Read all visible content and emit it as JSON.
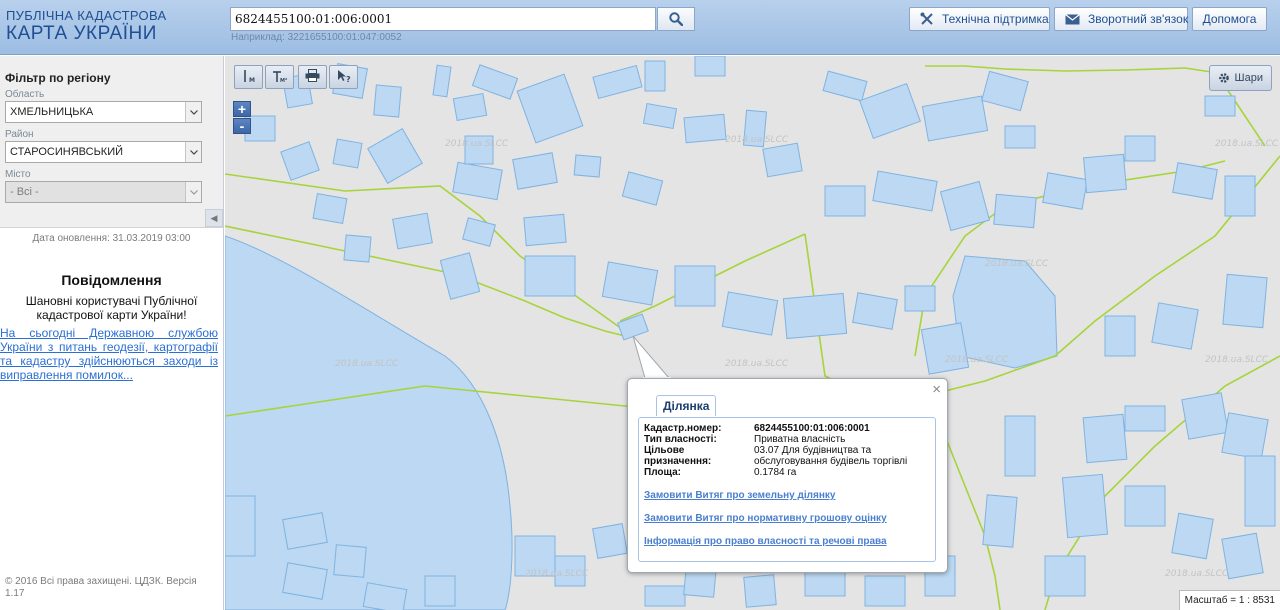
{
  "header": {
    "logo_line1": "ПУБЛІЧНА КАДАСТРОВА",
    "logo_line2": "КАРТА УКРАЇНИ",
    "search_value": "6824455100:01:006:0001",
    "search_hint": "Наприклад: 3221655100:01:047:0052",
    "search_icon": "search-icon",
    "support_label": "Технічна підтримка",
    "feedback_label": "Зворотний зв'язок",
    "help_label": "Допомога"
  },
  "sidebar": {
    "filter_title": "Фільтр по регіону",
    "region_label": "Область",
    "region_value": "ХМЕЛЬНИЦЬКА",
    "district_label": "Район",
    "district_value": "СТАРОСИНЯВСЬКИЙ",
    "city_label": "Місто",
    "city_value": "- Всі -",
    "update_text": "Дата оновлення: 31.03.2019 03:00",
    "notice_title": "Повідомлення",
    "notice_text": "Шановні користувачі Публічної кадастрової карти України!",
    "notice_link": "На сьогодні Державною службою України з питань геодезії, картографії та кадастру здійснюються заходи із виправлення помилок...",
    "copyright": "© 2016 Всі права захищені. ЦДЗК. Версія 1.17"
  },
  "map": {
    "layers_label": "Шари",
    "zoom_in": "+",
    "zoom_out": "-",
    "scale_text": "Масштаб = 1 : 8531",
    "watermark": "2018.ua.SLCC",
    "tools": [
      "ruler-icon",
      "area-ruler-icon",
      "print-icon",
      "info-cursor-icon"
    ]
  },
  "popup": {
    "tab_label": "Ділянка",
    "close": "×",
    "fields": [
      {
        "key": "Кадастр.номер:",
        "value": "6824455100:01:006:0001"
      },
      {
        "key": "Тип власності:",
        "value": "Приватна власність"
      },
      {
        "key": "Цільове призначення:",
        "value": "03.07 Для будівництва та обслуговування будівель торгівлі"
      },
      {
        "key": "Площа:",
        "value": "0.1784 га"
      }
    ],
    "links": [
      "Замовити Витяг про земельну ділянку",
      "Замовити Витяг про нормативну грошову оцінку",
      "Інформація про право власності та речові права"
    ]
  },
  "colors": {
    "parcel_fill": "#bcd8f2",
    "parcel_stroke": "#7fb3e2",
    "boundary": "#a6d43a",
    "map_bg": "#e4e4e4",
    "link": "#2a6fd3"
  }
}
